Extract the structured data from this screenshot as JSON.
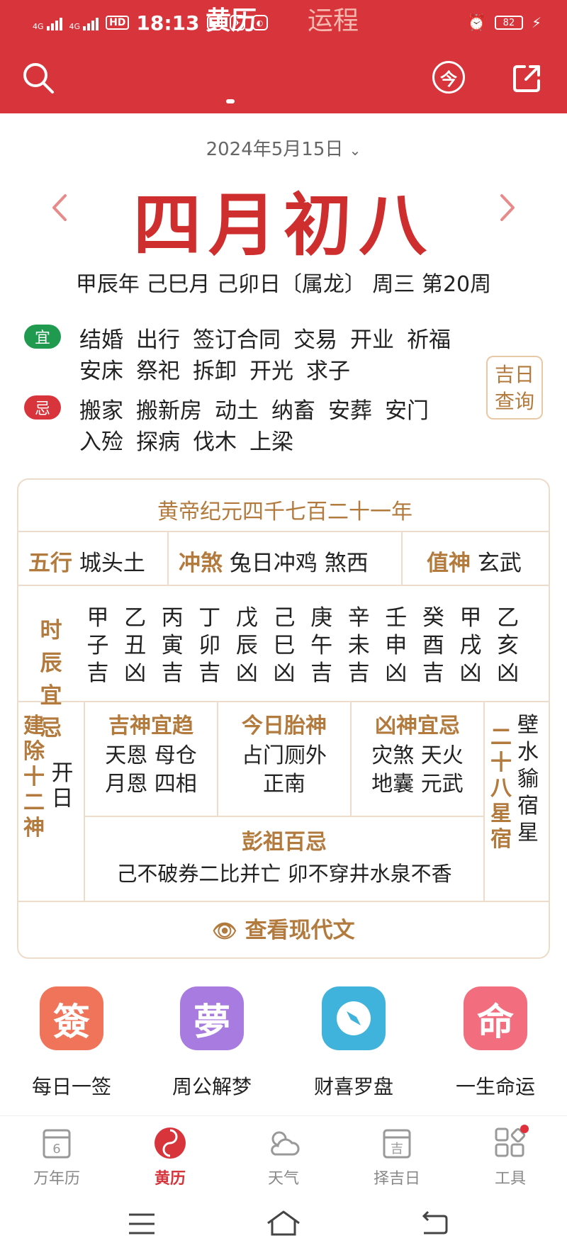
{
  "status_bar": {
    "time": "18:13",
    "signal1": "4G",
    "signal2": "4G",
    "hd": "HD",
    "battery": "82"
  },
  "header": {
    "tabs": [
      {
        "label": "黄历"
      },
      {
        "label": "运程"
      }
    ],
    "today_label": "今"
  },
  "date": {
    "selected": "2024年5月15日",
    "lunar": "四月初八",
    "ganzhi": "甲辰年 己巳月 己卯日〔属龙〕 周三  第20周"
  },
  "yi": {
    "label": "宜",
    "items": [
      "结婚",
      "出行",
      "签订合同",
      "交易",
      "开业",
      "祈福",
      "安床",
      "祭祀",
      "拆卸",
      "开光",
      "求子"
    ]
  },
  "ji": {
    "label": "忌",
    "items": [
      "搬家",
      "搬新房",
      "动土",
      "纳畜",
      "安葬",
      "安门",
      "入殓",
      "探病",
      "伐木",
      "上梁"
    ]
  },
  "query_button": "吉日查询",
  "almanac": {
    "era": "黄帝纪元四千七百二十一年",
    "wuxing": {
      "label": "五行",
      "value": "城头土"
    },
    "chongsha": {
      "label": "冲煞",
      "value": "兔日冲鸡 煞西"
    },
    "zhishen": {
      "label": "值神",
      "value": "玄武"
    },
    "hours_title": "时辰宜忌",
    "hours": [
      {
        "stem": "甲",
        "branch": "子",
        "luck": "吉"
      },
      {
        "stem": "乙",
        "branch": "丑",
        "luck": "凶"
      },
      {
        "stem": "丙",
        "branch": "寅",
        "luck": "吉"
      },
      {
        "stem": "丁",
        "branch": "卯",
        "luck": "吉"
      },
      {
        "stem": "戊",
        "branch": "辰",
        "luck": "凶"
      },
      {
        "stem": "己",
        "branch": "巳",
        "luck": "凶"
      },
      {
        "stem": "庚",
        "branch": "午",
        "luck": "吉"
      },
      {
        "stem": "辛",
        "branch": "未",
        "luck": "吉"
      },
      {
        "stem": "壬",
        "branch": "申",
        "luck": "凶"
      },
      {
        "stem": "癸",
        "branch": "酉",
        "luck": "吉"
      },
      {
        "stem": "甲",
        "branch": "戌",
        "luck": "凶"
      },
      {
        "stem": "乙",
        "branch": "亥",
        "luck": "凶"
      }
    ],
    "jianchu": {
      "label": "建除十二神",
      "value": "开日"
    },
    "jishen": {
      "label": "吉神宜趋",
      "line1": "天恩 母仓",
      "line2": "月恩 四相"
    },
    "taishen": {
      "label": "今日胎神",
      "line1": "占门厕外",
      "line2": "正南"
    },
    "xiongshen": {
      "label": "凶神宜忌",
      "line1": "灾煞 天火",
      "line2": "地囊 元武"
    },
    "xiu": {
      "label": "二十八星宿",
      "value": "壁水貐宿星"
    },
    "pengzu": {
      "label": "彭祖百忌",
      "value": "己不破券二比并亡 卯不穿井水泉不香"
    },
    "modern_link": "查看现代文"
  },
  "tools": [
    {
      "glyph": "簽",
      "label": "每日一签",
      "color": "#f0745a"
    },
    {
      "glyph": "夢",
      "label": "周公解梦",
      "color": "#a87be0"
    },
    {
      "glyph": "",
      "label": "财喜罗盘",
      "color": "#3fb3dc"
    },
    {
      "glyph": "命",
      "label": "一生命运",
      "color": "#f26d7d"
    }
  ],
  "bottom_nav": [
    {
      "label": "万年历",
      "glyph": "6"
    },
    {
      "label": "黄历"
    },
    {
      "label": "天气"
    },
    {
      "label": "择吉日",
      "glyph": "吉"
    },
    {
      "label": "工具"
    }
  ]
}
